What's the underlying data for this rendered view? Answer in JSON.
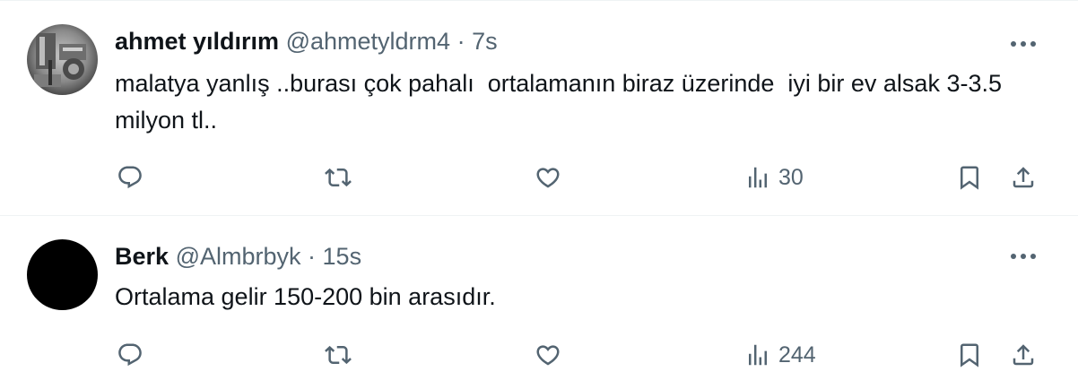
{
  "tweets": [
    {
      "author_name": "ahmet yıldırım",
      "handle": "@ahmetyldrm4",
      "separator": "·",
      "time": "7s",
      "text": "malatya yanlış ..burası çok pahalı  ortalamanın biraz üzerinde  iyi bir ev alsak 3-3.5 milyon tl..",
      "views": "30"
    },
    {
      "author_name": "Berk",
      "handle": "@Almbrbyk",
      "separator": "·",
      "time": "15s",
      "text": "Ortalama gelir 150-200 bin arasıdır.",
      "views": "244"
    }
  ],
  "icons": {
    "more": "more-icon",
    "reply": "reply-icon",
    "retweet": "retweet-icon",
    "like": "like-icon",
    "views": "views-icon",
    "bookmark": "bookmark-icon",
    "share": "share-icon"
  },
  "colors": {
    "text_primary": "#0f1419",
    "text_secondary": "#536471",
    "divider": "#eff3f4",
    "avatar_berk": "#000000"
  }
}
